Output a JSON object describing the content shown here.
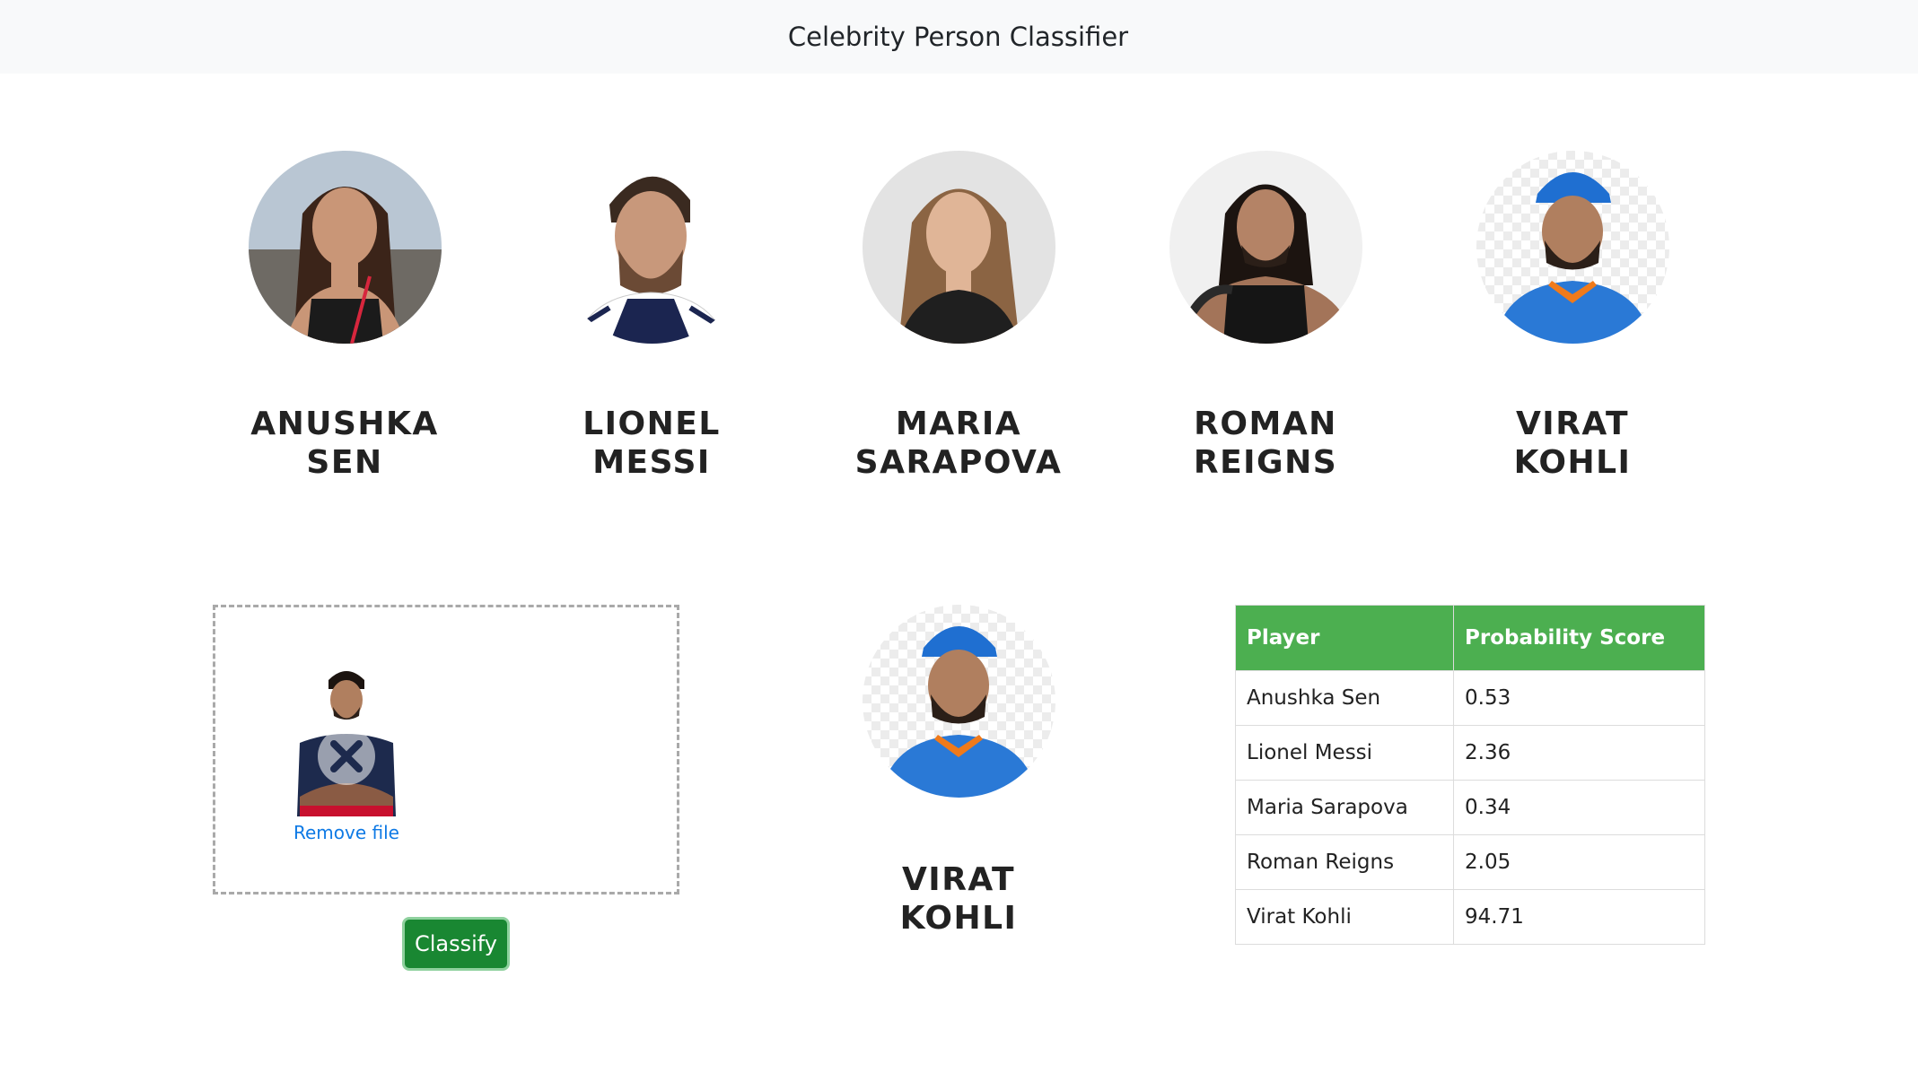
{
  "navbar": {
    "title": "Celebrity Person Classifier"
  },
  "celebrities": [
    {
      "name": "ANUSHKA SEN",
      "icon": "anushka-sen-photo"
    },
    {
      "name": "LIONEL MESSI",
      "icon": "lionel-messi-photo"
    },
    {
      "name": "MARIA SARAPOVA",
      "icon": "maria-sarapova-photo"
    },
    {
      "name": "ROMAN REIGNS",
      "icon": "roman-reigns-photo"
    },
    {
      "name": "VIRAT KOHLI",
      "icon": "virat-kohli-photo"
    }
  ],
  "upload": {
    "remove_label": "Remove file",
    "thumbnail_icon": "uploaded-image-thumbnail"
  },
  "classify_button": {
    "label": "Classify"
  },
  "result": {
    "name": "VIRAT KOHLI",
    "icon": "virat-kohli-photo"
  },
  "table": {
    "headers": [
      "Player",
      "Probability Score"
    ],
    "rows": [
      [
        "Anushka Sen",
        "0.53"
      ],
      [
        "Lionel Messi",
        "2.36"
      ],
      [
        "Maria Sarapova",
        "0.34"
      ],
      [
        "Roman Reigns",
        "2.05"
      ],
      [
        "Virat Kohli",
        "94.71"
      ]
    ]
  },
  "colors": {
    "navbar_bg": "#f8f9fa",
    "table_header": "#4caf50",
    "classify_button": "#198732",
    "link": "#0f7ae5"
  }
}
